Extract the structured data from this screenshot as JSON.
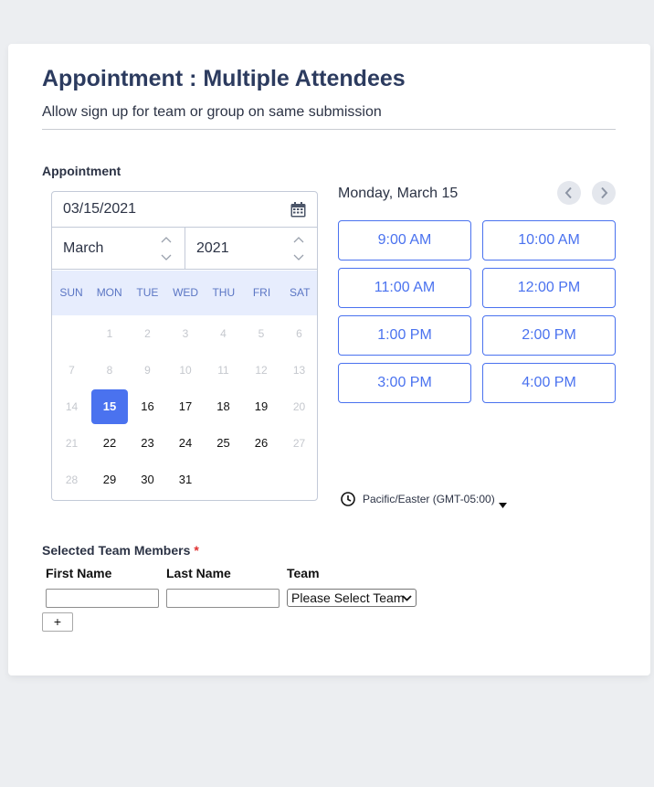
{
  "form": {
    "title": "Appointment : Multiple Attendees",
    "subtitle": "Allow sign up for team or group on same submission"
  },
  "appointment": {
    "label": "Appointment",
    "date_value": "03/15/2021",
    "month": "March",
    "year": "2021",
    "weekdays": [
      "SUN",
      "MON",
      "TUE",
      "WED",
      "THU",
      "FRI",
      "SAT"
    ],
    "weeks": [
      [
        "",
        "1",
        "2",
        "3",
        "4",
        "5",
        "6"
      ],
      [
        "7",
        "8",
        "9",
        "10",
        "11",
        "12",
        "13"
      ],
      [
        "14",
        "15",
        "16",
        "17",
        "18",
        "19",
        "20"
      ],
      [
        "21",
        "22",
        "23",
        "24",
        "25",
        "26",
        "27"
      ],
      [
        "28",
        "29",
        "30",
        "31",
        "",
        "",
        ""
      ]
    ],
    "selected_day": "15",
    "enabled_days": [
      "15",
      "16",
      "17",
      "18",
      "19",
      "22",
      "23",
      "24",
      "25",
      "26",
      "29",
      "30",
      "31"
    ],
    "selected_date_label": "Monday, March 15",
    "time_slots": [
      "9:00 AM",
      "10:00 AM",
      "11:00 AM",
      "12:00 PM",
      "1:00 PM",
      "2:00 PM",
      "3:00 PM",
      "4:00 PM"
    ],
    "timezone": "Pacific/Easter (GMT-05:00)",
    "icons": {
      "calendar": "calendar-icon",
      "prev": "chevron-left-icon",
      "next": "chevron-right-icon",
      "clock": "clock-icon"
    }
  },
  "team_members": {
    "label": "Selected Team Members",
    "required_mark": "*",
    "columns": [
      "First Name",
      "Last Name",
      "Team"
    ],
    "first_name_value": "",
    "last_name_value": "",
    "team_selected": "Please Select Team",
    "add_label": "+"
  },
  "colors": {
    "accent": "#4a72ef",
    "title": "#2c3b5f",
    "weekday_bg": "#e7edfd",
    "required": "#e03131"
  }
}
